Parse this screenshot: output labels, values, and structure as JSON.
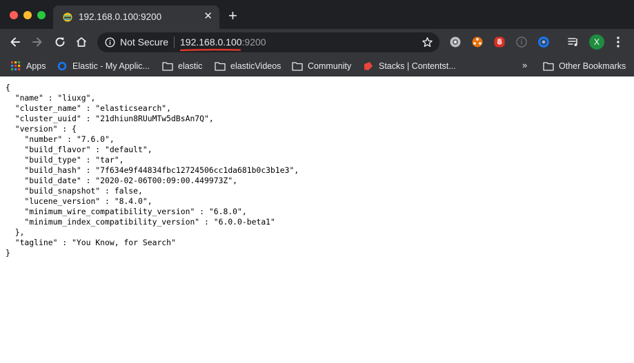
{
  "tab": {
    "title": "192.168.0.100:9200",
    "close_label": "✕",
    "new_tab_label": "+"
  },
  "omnibox": {
    "security_label": "Not Secure",
    "url_host": "192.168.0.100",
    "url_port": ":9200"
  },
  "profile": {
    "initial": "X"
  },
  "bookmarks": {
    "items": [
      {
        "label": "Apps",
        "icon": "apps-grid-icon"
      },
      {
        "label": "Elastic - My Applic...",
        "icon": "elastic-favicon-icon"
      },
      {
        "label": "elastic",
        "icon": "folder-icon"
      },
      {
        "label": "elasticVideos",
        "icon": "folder-icon"
      },
      {
        "label": "Community",
        "icon": "folder-icon"
      },
      {
        "label": "Stacks | Contentst...",
        "icon": "contentstack-icon"
      }
    ],
    "overflow_label": "»",
    "other_label": "Other Bookmarks"
  },
  "json_lines": [
    "{",
    "  \"name\" : \"liuxg\",",
    "  \"cluster_name\" : \"elasticsearch\",",
    "  \"cluster_uuid\" : \"21dhiun8RUuMTw5dBsAn7Q\",",
    "  \"version\" : {",
    "    \"number\" : \"7.6.0\",",
    "    \"build_flavor\" : \"default\",",
    "    \"build_type\" : \"tar\",",
    "    \"build_hash\" : \"7f634e9f44834fbc12724506cc1da681b0c3b1e3\",",
    "    \"build_date\" : \"2020-02-06T00:09:00.449973Z\",",
    "    \"build_snapshot\" : false,",
    "    \"lucene_version\" : \"8.4.0\",",
    "    \"minimum_wire_compatibility_version\" : \"6.8.0\",",
    "    \"minimum_index_compatibility_version\" : \"6.0.0-beta1\"",
    "  },",
    "  \"tagline\" : \"You Know, for Search\"",
    "}"
  ],
  "colors": {
    "annotation_underline": "#e0392b",
    "avatar": "#1e8e3e"
  }
}
